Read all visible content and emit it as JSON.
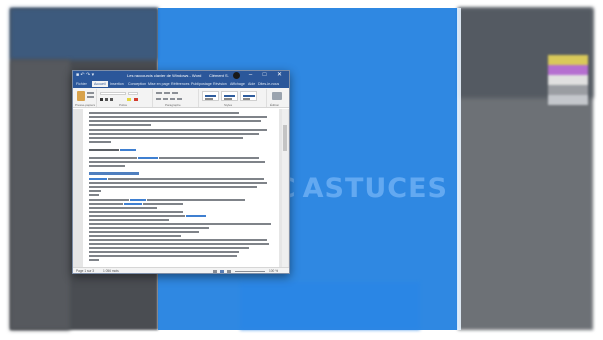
{
  "colors": {
    "snap_overlay": "#1f7fe0",
    "word_brand": "#2b579a",
    "desktop_left": "#4a4d52",
    "desktop_right": "#6d7176"
  },
  "watermark": {
    "left_text": "PC",
    "right_text": "ASTUCES"
  },
  "word": {
    "quick_access": "■ ↶ ↷ ▾",
    "title": "Les raccourcis clavier de Windows - Word",
    "user": "Clément S.",
    "controls": {
      "minimize": "–",
      "maximize": "□",
      "close": "✕"
    },
    "tabs": [
      "Fichier",
      "Accueil",
      "Insertion",
      "Conception",
      "Mise en page",
      "Références",
      "Publipostage",
      "Révision",
      "Affichage",
      "Aide",
      "Dites-le-nous"
    ],
    "active_tab": 1,
    "ribbon_groups": [
      "Presse-papiers",
      "Police",
      "Paragraphe",
      "Styles",
      "Édition"
    ],
    "styles": [
      "AaBbCcDc",
      "AaBbCcDc",
      "AaBbCc"
    ],
    "status": {
      "page": "Page 1 sur 3",
      "words": "1 056 mots",
      "zoom": "100 %"
    },
    "icons": [
      "save-icon",
      "undo-icon",
      "redo-icon",
      "paste-icon",
      "scrollbar-thumb"
    ]
  }
}
